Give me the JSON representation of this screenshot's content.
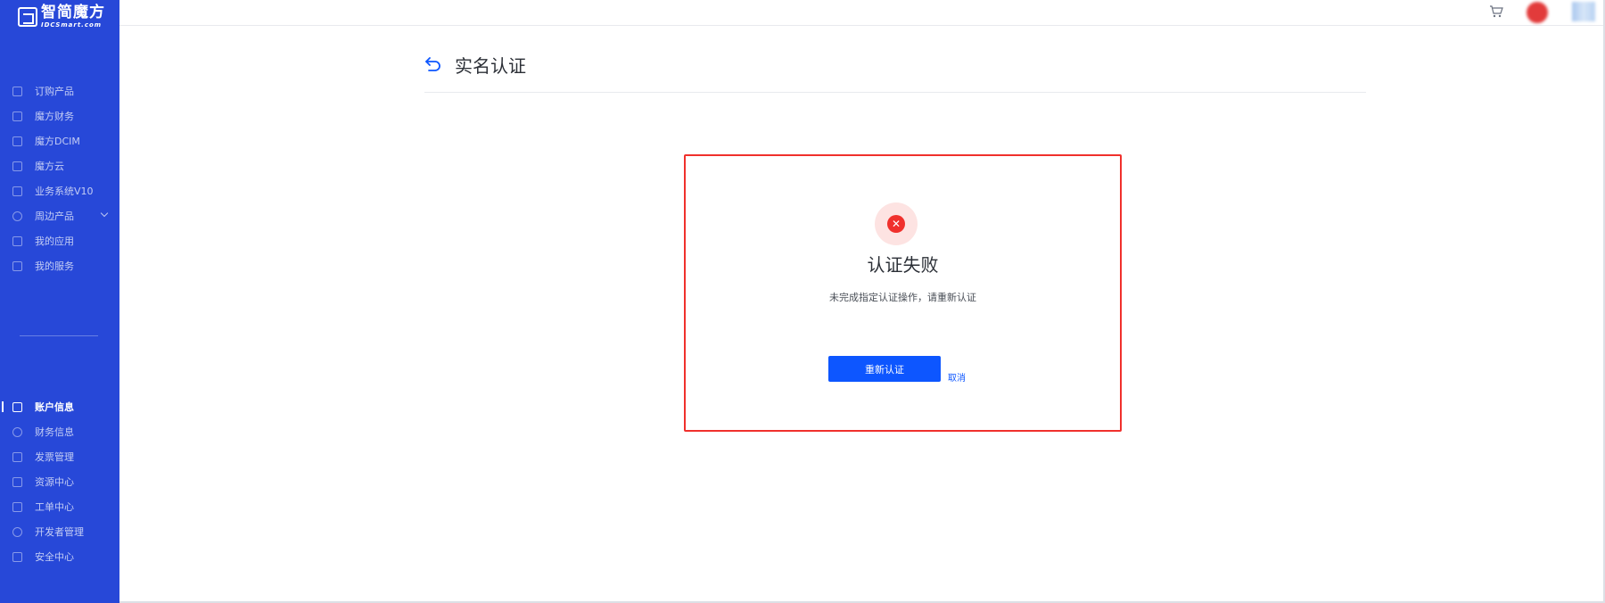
{
  "brand": {
    "name_cn": "智简魔方",
    "name_en": "IDCSmart.com"
  },
  "sidebar": {
    "top_items": [
      {
        "label": "订购产品"
      },
      {
        "label": "魔方财务"
      },
      {
        "label": "魔方DCIM"
      },
      {
        "label": "魔方云"
      },
      {
        "label": "业务系统V10"
      },
      {
        "label": "周边产品"
      },
      {
        "label": "我的应用"
      },
      {
        "label": "我的服务"
      }
    ],
    "bottom_items": [
      {
        "label": "账户信息"
      },
      {
        "label": "财务信息"
      },
      {
        "label": "发票管理"
      },
      {
        "label": "资源中心"
      },
      {
        "label": "工单中心"
      },
      {
        "label": "开发者管理"
      },
      {
        "label": "安全中心"
      }
    ],
    "active_item": "账户信息"
  },
  "page": {
    "title": "实名认证"
  },
  "result": {
    "title": "认证失败",
    "description": "未完成指定认证操作，请重新认证",
    "retry_label": "重新认证",
    "cancel_label": "取消"
  },
  "colors": {
    "sidebar_bg": "#2748d8",
    "primary": "#0d56ff",
    "error": "#f0302c"
  }
}
